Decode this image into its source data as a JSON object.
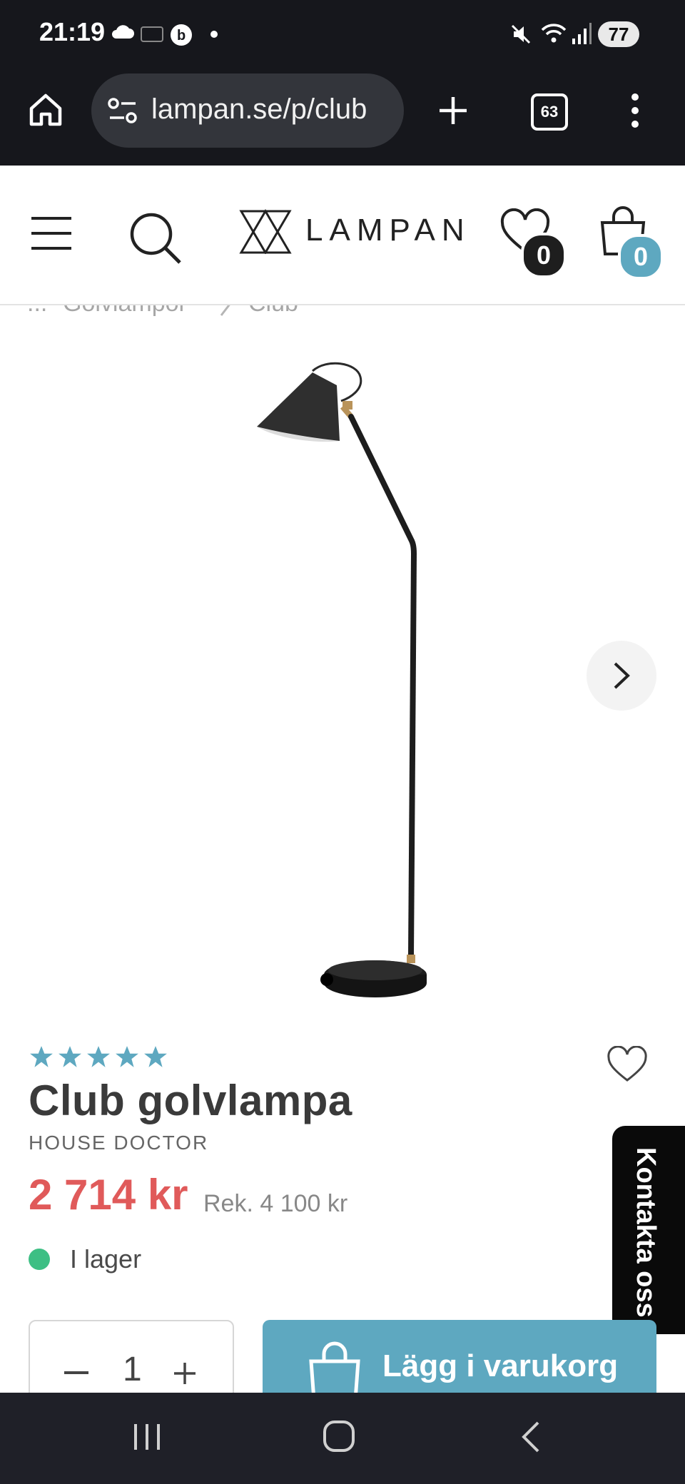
{
  "status_bar": {
    "time": "21:19",
    "battery": "77"
  },
  "browser": {
    "url": "lampan.se/p/club",
    "tab_count": "63"
  },
  "site_header": {
    "logo": "LAMPAN",
    "wishlist_count": "0",
    "cart_count": "0"
  },
  "breadcrumb": {
    "ellipsis": "...",
    "category": "Golvlampor",
    "current": "Club"
  },
  "product": {
    "rating": 5,
    "title": "Club golvlampa",
    "brand": "HOUSE DOCTOR",
    "price": "2 714 kr",
    "recommended_price": "Rek. 4 100 kr",
    "stock": "I lager",
    "quantity": "1",
    "add_to_cart": "Lägg i varukorg"
  },
  "contact": {
    "label": "Kontakta oss"
  },
  "colors": {
    "accent": "#5ea8c0",
    "price": "#e05a5a",
    "stock": "#3dbf84"
  }
}
